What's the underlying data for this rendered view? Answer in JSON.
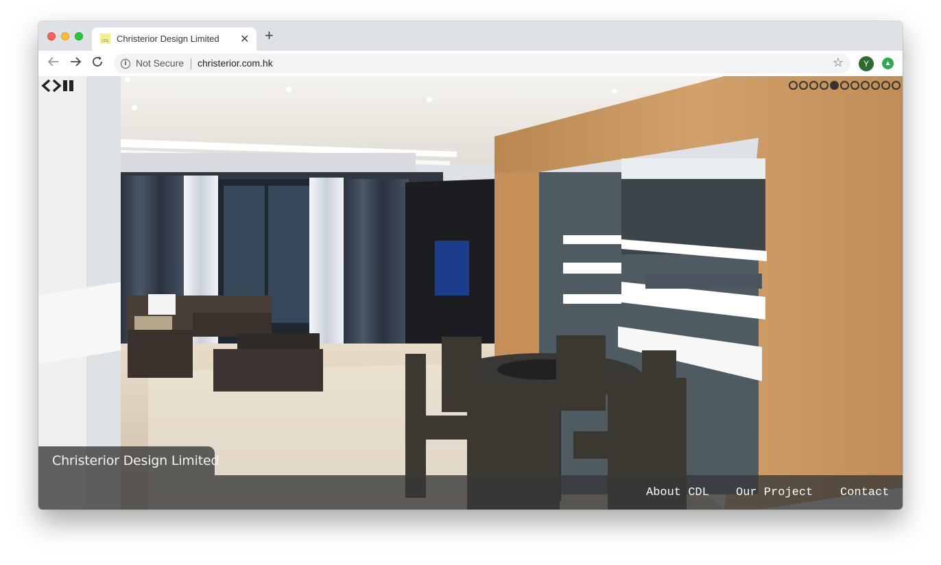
{
  "browser": {
    "tab": {
      "title": "Christerior Design Limited",
      "favicon_text": "CDL"
    },
    "address_bar": {
      "security_label": "Not Secure",
      "url": "christerior.com.hk"
    },
    "profile_initial": "Y"
  },
  "slideshow": {
    "total_slides": 11,
    "active_index": 4
  },
  "page": {
    "brand_caption": "Christerior Design Limited",
    "menu": [
      {
        "label": "About CDL"
      },
      {
        "label": "Our Project"
      },
      {
        "label": "Contact"
      }
    ]
  },
  "colors": {
    "window_chrome": "#dee1e6",
    "caption_bg": "#373737",
    "wood": "#c9945a",
    "wall_dark": "#3c4549"
  }
}
